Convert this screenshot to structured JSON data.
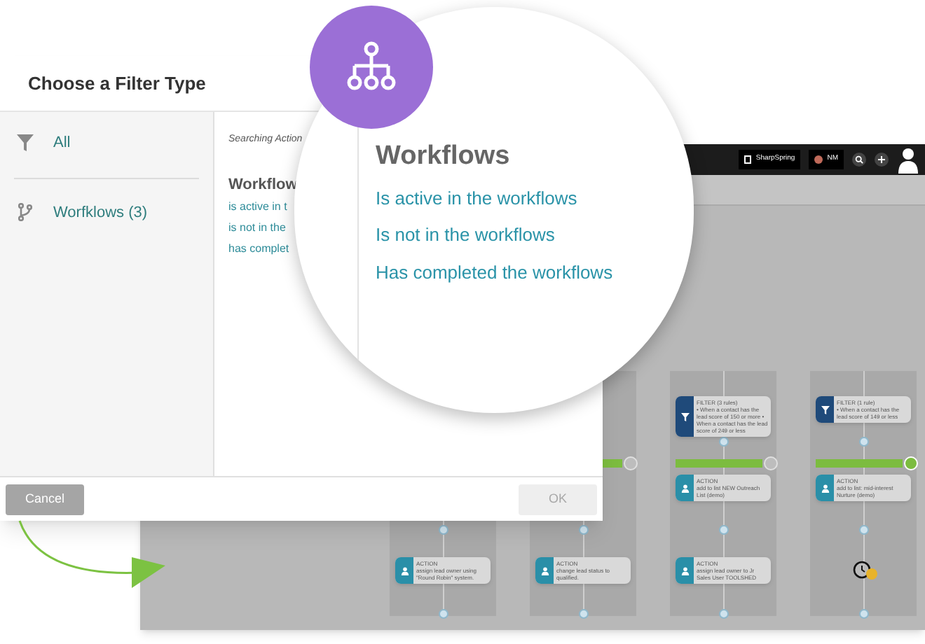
{
  "filter_dialog": {
    "title": "Choose a Filter Type",
    "categories": [
      {
        "label": "All",
        "kind": "filter"
      },
      {
        "label": "Worfklows (3)",
        "kind": "branch"
      }
    ],
    "search_heading": "Searching Action",
    "results": {
      "heading": "Workflow",
      "options": [
        "is active in t",
        "is not in the",
        "has complet"
      ]
    },
    "buttons": [
      {
        "label": "Cancel",
        "disabled": false
      },
      {
        "label": "OK",
        "disabled": true
      }
    ]
  },
  "magnifier": {
    "heading": "Workflows",
    "options": [
      "Is active in the workflows",
      "Is not in the workflows",
      "Has completed the workflows"
    ]
  },
  "workflow_app": {
    "topbar": {
      "account": "SharpSpring",
      "user": "NM"
    },
    "columns": [
      {
        "next_step": {
          "kind": "action",
          "title": "ACTION",
          "text": "assign lead owner using \"Round Robin\" system."
        }
      },
      {
        "branch": {
          "done": false
        },
        "next_step": {
          "kind": "action",
          "title": "ACTION",
          "text": "change lead status to qualified."
        }
      },
      {
        "filter": {
          "title": "FILTER (3 rules)",
          "text": "• When a contact has the lead score of 150 or more • When a contact has the lead score of 249 or less"
        },
        "branch": {
          "done": false
        },
        "action": {
          "title": "ACTION",
          "text": "add to list NEW Outreach List (demo)"
        },
        "next_step": {
          "kind": "action",
          "title": "ACTION",
          "text": "assign lead owner to Jr Sales User TOOLSHED"
        }
      },
      {
        "filter": {
          "title": "FILTER (1 rule)",
          "text": "• When a contact has the lead score of 149 or less"
        },
        "branch": {
          "done": true
        },
        "action": {
          "title": "ACTION",
          "text": "add to list: mid-interest Nurture (demo)"
        },
        "next_step": {
          "kind": "timer"
        }
      }
    ]
  }
}
